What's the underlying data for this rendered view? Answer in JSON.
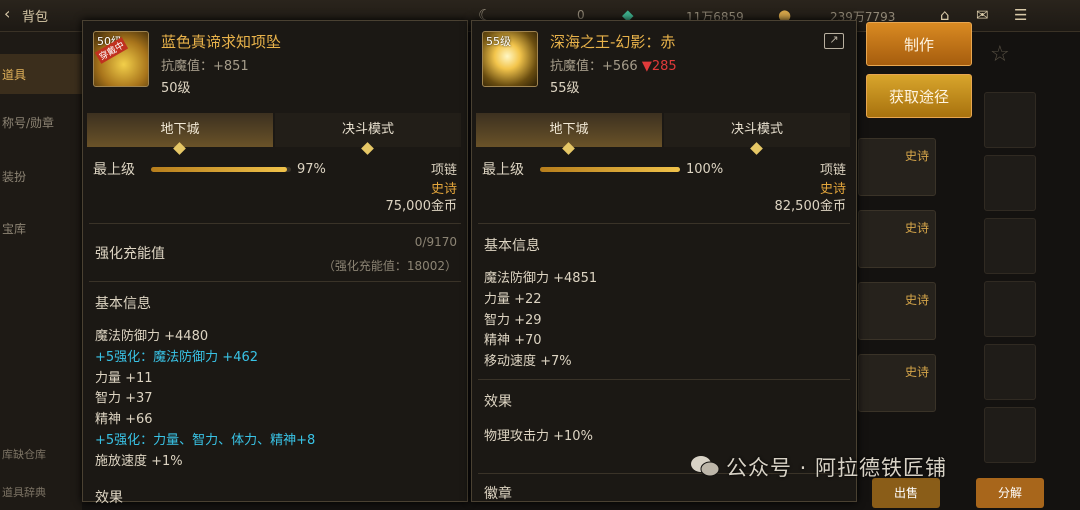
{
  "background": {
    "title": "背包",
    "currency_counts": [
      "0",
      "11万6859",
      "239万7793"
    ],
    "side_items": [
      "道具",
      "称号/勋章",
      "装扮",
      "宝库"
    ],
    "side_bottom": [
      "库缺仓库",
      "道具辞典"
    ],
    "epic_rows": [
      "史诗",
      "史诗",
      "史诗",
      "史诗",
      "史诗"
    ],
    "bottom_buttons": [
      "出售",
      "分解"
    ]
  },
  "left_item": {
    "level_tag": "50级",
    "equip_tag": "穿戴中",
    "name": "蓝色真谛求知项坠",
    "anti_magic": "抗魔值：+851",
    "level": "50级",
    "tabs": [
      "地下城",
      "决斗模式"
    ],
    "bar_label": "最上级",
    "bar_pct_text": "97%",
    "bar_pct": 0.97,
    "slot": "项链",
    "rarity": "史诗",
    "price": "75,000金币",
    "charge_title": "强化充能值",
    "charge_value": "0/9170",
    "charge_sub": "（强化充能值：18002）",
    "basic_title": "基本信息",
    "stats": [
      {
        "text": "魔法防御力 +4480",
        "cyan": false
      },
      {
        "text": "+5强化：魔法防御力 +462",
        "cyan": true
      },
      {
        "text": "力量 +11",
        "cyan": false
      },
      {
        "text": "智力 +37",
        "cyan": false
      },
      {
        "text": "精神 +66",
        "cyan": false
      },
      {
        "text": "+5强化：力量、智力、体力、精神+8",
        "cyan": true
      },
      {
        "text": "施放速度 +1%",
        "cyan": false
      }
    ],
    "next_title": "效果"
  },
  "right_item": {
    "level_tag": "55级",
    "name": "深海之王-幻影：赤",
    "anti_magic": "抗魔值：+566",
    "anti_magic_diff": "▼285",
    "level": "55级",
    "tabs": [
      "地下城",
      "决斗模式"
    ],
    "bar_label": "最上级",
    "bar_pct_text": "100%",
    "bar_pct": 1.0,
    "slot": "项链",
    "rarity": "史诗",
    "price": "82,500金币",
    "basic_title": "基本信息",
    "stats": [
      "魔法防御力 +4851",
      "力量 +22",
      "智力 +29",
      "精神 +70",
      "移动速度 +7%"
    ],
    "effect_title": "效果",
    "effects": [
      "物理攻击力 +10%"
    ],
    "next_title": "徽章"
  },
  "actions": {
    "make": "制作",
    "obtain": "获取途径"
  },
  "watermark": "公众号 · 阿拉德铁匠铺",
  "colors": {
    "gold": "#e8b24a",
    "cyan": "#39c3e6",
    "red": "#e03a3a",
    "orange_button": "#d98a22"
  }
}
